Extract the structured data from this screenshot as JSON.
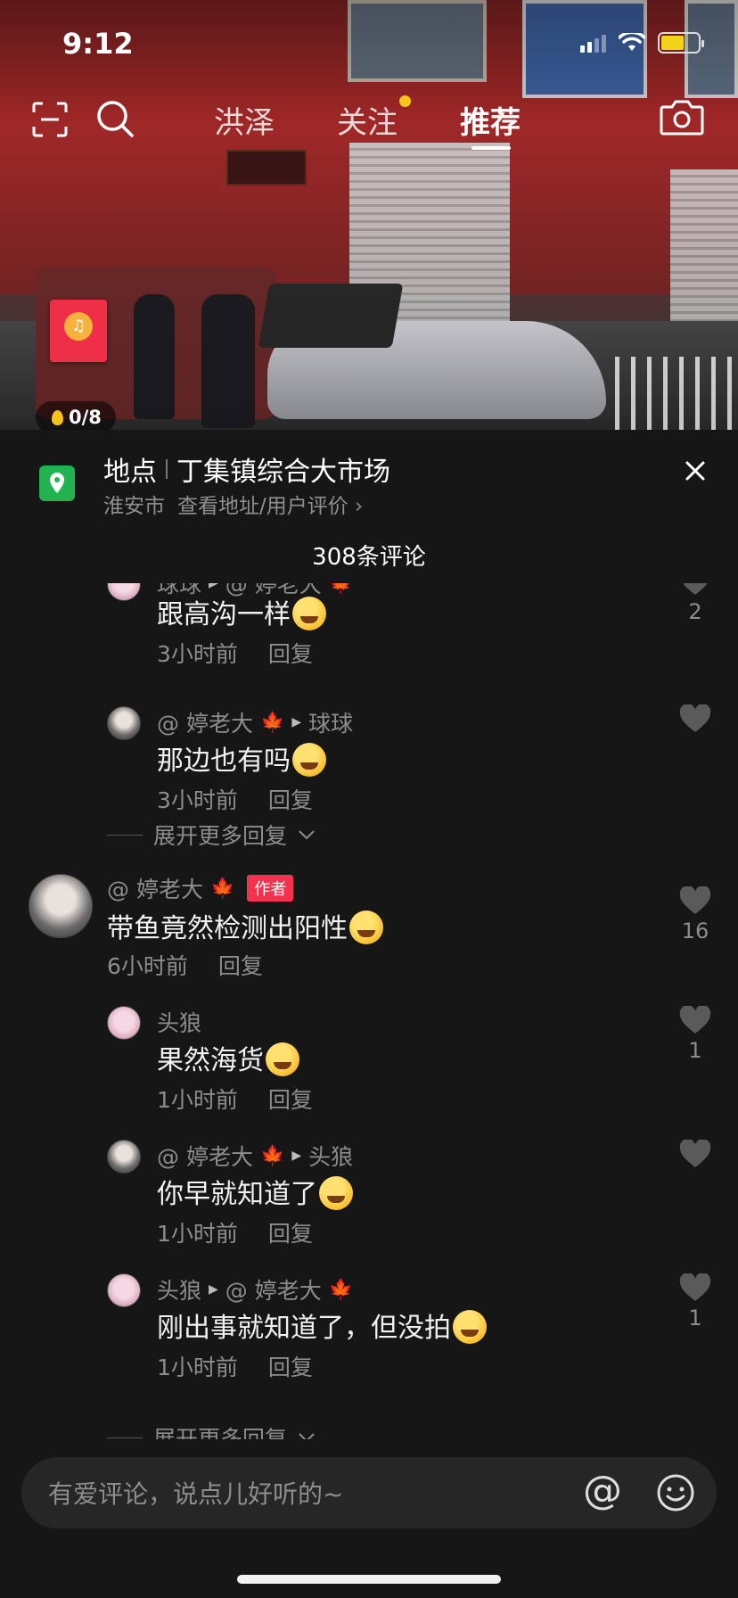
{
  "status_bar": {
    "time": "9:12"
  },
  "top_nav": {
    "tabs": [
      {
        "label": "洪泽"
      },
      {
        "label": "关注"
      },
      {
        "label": "推荐"
      }
    ],
    "active_tab": "推荐",
    "notification_color": "#f9c61a"
  },
  "red_packet": {
    "progress": "0/8",
    "accent_color": "#ef2e47"
  },
  "location": {
    "label": "地点",
    "name": "丁集镇综合大市场",
    "city": "淮安市",
    "link": "查看地址/用户评价 ›",
    "icon_color": "#22b250"
  },
  "comments_header": {
    "count_label": "308条评论"
  },
  "comments": [
    {
      "user": "球球",
      "reply_to": "@ 婷老大",
      "text": "跟高沟一样",
      "time": "3小时前",
      "reply": "回复",
      "likes": "2"
    },
    {
      "user": "@ 婷老大",
      "reply_to": "球球",
      "text": "那边也有吗",
      "time": "3小时前",
      "reply": "回复",
      "likes": ""
    },
    {
      "expand": "展开更多回复"
    },
    {
      "user": "@ 婷老大",
      "badge": "作者",
      "text": "带鱼竟然检测出阳性",
      "time": "6小时前",
      "reply": "回复",
      "likes": "16"
    },
    {
      "user": "头狼",
      "text": "果然海货",
      "time": "1小时前",
      "reply": "回复",
      "likes": "1"
    },
    {
      "user": "@ 婷老大",
      "reply_to": "头狼",
      "text": "你早就知道了",
      "time": "1小时前",
      "reply": "回复",
      "likes": ""
    },
    {
      "user": "头狼",
      "reply_to": "@ 婷老大",
      "text": "刚出事就知道了，但没拍",
      "time": "1小时前",
      "reply": "回复",
      "likes": "1"
    },
    {
      "expand": "展开更多回复"
    }
  ],
  "input": {
    "placeholder": "有爱评论，说点儿好听的~"
  },
  "colors": {
    "author_badge": "#f3324f",
    "panel_bg": "#161616"
  }
}
